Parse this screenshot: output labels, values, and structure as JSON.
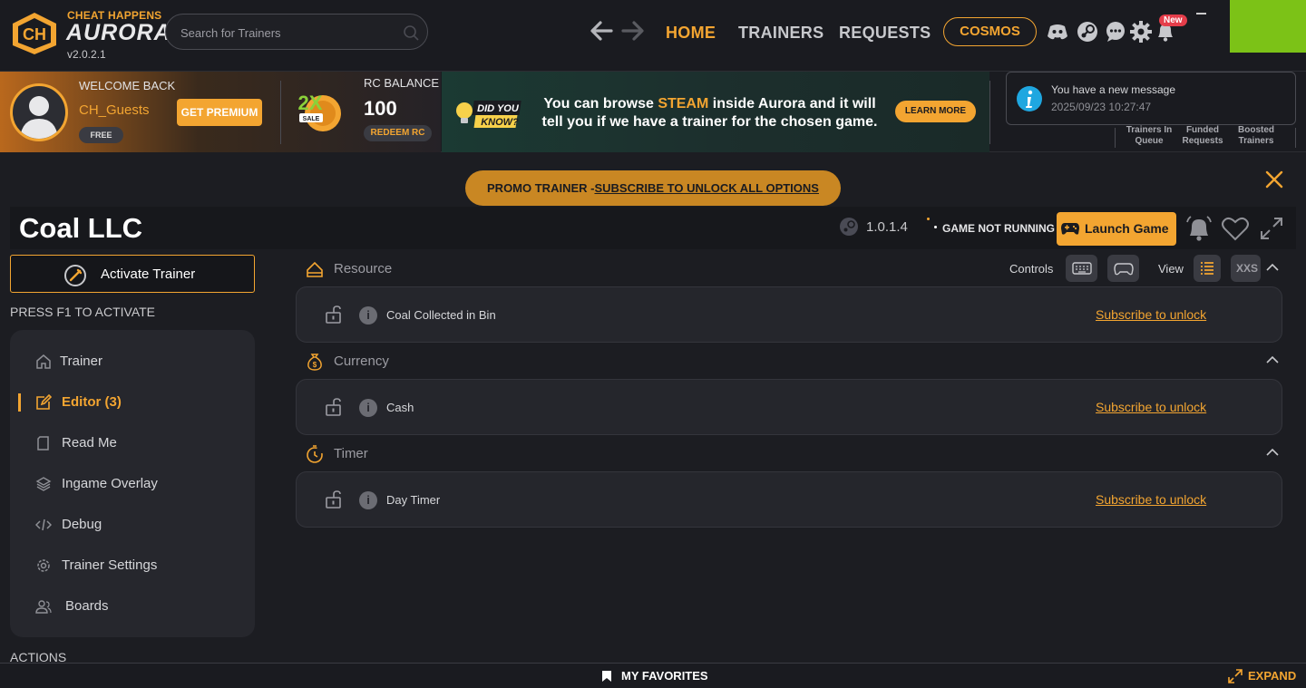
{
  "brand": {
    "small": "CHEAT HAPPENS",
    "big": "AURORA",
    "version": "v2.0.2.1"
  },
  "search": {
    "placeholder": "Search for Trainers"
  },
  "nav": {
    "home": "HOME",
    "trainers": "TRAINERS",
    "requests": "REQUESTS",
    "cosmos": "COSMOS",
    "new_badge": "New"
  },
  "user": {
    "welcome": "WELCOME BACK",
    "name": "CH_Guests",
    "tier": "FREE",
    "premium_btn": "GET PREMIUM"
  },
  "sale": {
    "big": "2X",
    "small": "SALE"
  },
  "rc": {
    "label": "RC BALANCE",
    "value": "100",
    "redeem": "REDEEM RC"
  },
  "did_you_know": {
    "badge_line1": "DID YOU",
    "badge_line2": "KNOW?",
    "text_part1": "You can browse ",
    "text_highlight": "STEAM",
    "text_part2": " inside Aurora and it will tell you if we have a trainer for the chosen game.",
    "learn_more": "LEARN MORE"
  },
  "message": {
    "title": "You have a new message",
    "time": "2025/09/23 10:27:47"
  },
  "stats": [
    {
      "line1": "Trainers In",
      "line2": "Queue"
    },
    {
      "line1": "Funded",
      "line2": "Requests"
    },
    {
      "line1": "Boosted",
      "line2": "Trainers"
    }
  ],
  "promo": {
    "prefix": "PROMO TRAINER -",
    "link": "SUBSCRIBE TO UNLOCK ALL OPTIONS"
  },
  "game": {
    "title": "Coal LLC",
    "version": "1.0.1.4",
    "status": "GAME NOT RUNNING",
    "launch": "Launch Game"
  },
  "sidebar": {
    "activate": "Activate Trainer",
    "hotkey_hint": "PRESS F1 TO ACTIVATE",
    "items": [
      {
        "label": "Trainer",
        "icon": "home-icon"
      },
      {
        "label": "Editor (3)",
        "icon": "edit-icon",
        "active": true
      },
      {
        "label": "Read Me",
        "icon": "document-icon"
      },
      {
        "label": "Ingame Overlay",
        "icon": "layers-icon"
      },
      {
        "label": "Debug",
        "icon": "code-icon"
      },
      {
        "label": "Trainer Settings",
        "icon": "gear-icon"
      },
      {
        "label": "Boards",
        "icon": "users-icon"
      }
    ],
    "actions_label": "ACTIONS"
  },
  "toolbar": {
    "controls": "Controls",
    "view": "View",
    "xxs": "XXS"
  },
  "sections": [
    {
      "title": "Resource",
      "icon": "resource-icon",
      "options": [
        {
          "label": "Coal Collected in Bin",
          "action": "Subscribe to unlock"
        }
      ]
    },
    {
      "title": "Currency",
      "icon": "money-bag-icon",
      "options": [
        {
          "label": "Cash",
          "action": "Subscribe to unlock"
        }
      ]
    },
    {
      "title": "Timer",
      "icon": "timer-icon",
      "options": [
        {
          "label": "Day Timer",
          "action": "Subscribe to unlock"
        }
      ]
    }
  ],
  "bottom": {
    "favorites": "MY FAVORITES",
    "expand": "EXPAND"
  },
  "colors": {
    "accent": "#f3a531",
    "background": "#1c1d22",
    "panel": "#26272d"
  }
}
